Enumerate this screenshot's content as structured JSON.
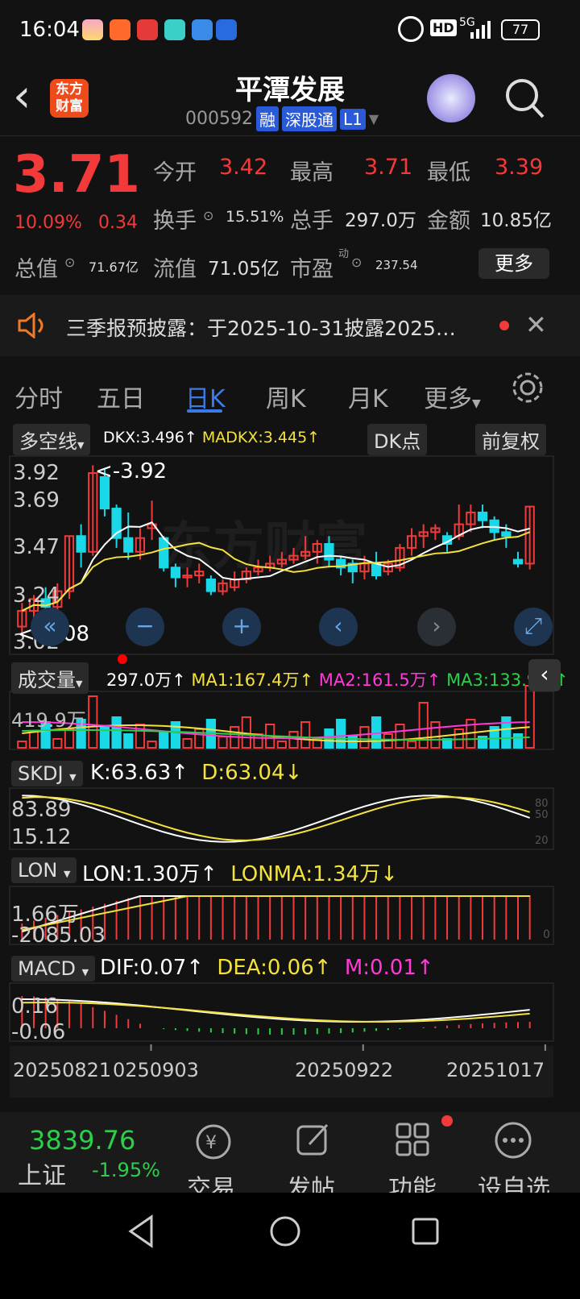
{
  "status": {
    "time": "16:04",
    "signal": "5G",
    "battery": "77",
    "hd": "HD"
  },
  "header": {
    "back": "‹",
    "logo": "东方\n财富",
    "title": "平潭发展",
    "code": "000592",
    "tags": [
      "融",
      "深股通",
      "L1"
    ]
  },
  "quote": {
    "price": "3.71",
    "pct": "10.09%",
    "chg": "0.34",
    "open_label": "今开",
    "open": "3.42",
    "high_label": "最高",
    "high": "3.71",
    "low_label": "最低",
    "low": "3.39",
    "turnover_label": "换手",
    "turnover": "15.51%",
    "volume_label": "总手",
    "volume": "297.0万",
    "amount_label": "金额",
    "amount": "10.85亿",
    "mcap_label": "总值",
    "mcap": "71.67亿",
    "float_label": "流值",
    "float": "71.05亿",
    "pe_label": "市盈",
    "pe_sup": "动",
    "pe": "237.54",
    "more": "更多"
  },
  "notice": {
    "text": "三季报预披露：于2025-10-31披露2025…"
  },
  "tabs": [
    "分时",
    "五日",
    "日K",
    "周K",
    "月K",
    "更多"
  ],
  "active_tab": "日K",
  "kline": {
    "indicator": "多空线",
    "dkx": "DKX:3.496↑",
    "madkx": "MADKX:3.445↑",
    "dk_btn": "DK点",
    "adj_btn": "前复权",
    "axis": [
      "3.92",
      "3.69",
      "3.47",
      "3.24",
      "3.02"
    ],
    "hi_label": "<-3.92",
    "lo_label": "<-3.08"
  },
  "volume": {
    "name": "成交量",
    "v": "297.0万↑",
    "ma1": "MA1:167.4万↑",
    "ma2": "MA2:161.5万↑",
    "ma3": "MA3:133.9万↑",
    "axis": "419.9万"
  },
  "skdj": {
    "name": "SKDJ",
    "k": "K:63.63↑",
    "d": "D:63.04↓",
    "axis_top": "83.89",
    "axis_bot": "15.12",
    "r80": "80",
    "r50": "50",
    "r20": "20"
  },
  "lon": {
    "name": "LON",
    "lon": "LON:1.30万↑",
    "lonma": "LONMA:1.34万↓",
    "axis_top": "1.66万",
    "axis_bot": "-2085.03",
    "r0": "0"
  },
  "macd": {
    "name": "MACD",
    "dif": "DIF:0.07↑",
    "dea": "DEA:0.06↑",
    "m": "M:0.01↑",
    "axis_top": "0.16",
    "axis_bot": "-0.06"
  },
  "dates": [
    "20250821",
    "0250903",
    "20250922",
    "20251017"
  ],
  "index": {
    "value": "3839.76",
    "name": "上证",
    "pct": "-1.95%"
  },
  "bottom": [
    "交易",
    "发帖",
    "功能",
    "设自选"
  ],
  "colors": {
    "up": "#f23a3a",
    "down": "#19d8e8",
    "accent": "#3a7be6"
  }
}
